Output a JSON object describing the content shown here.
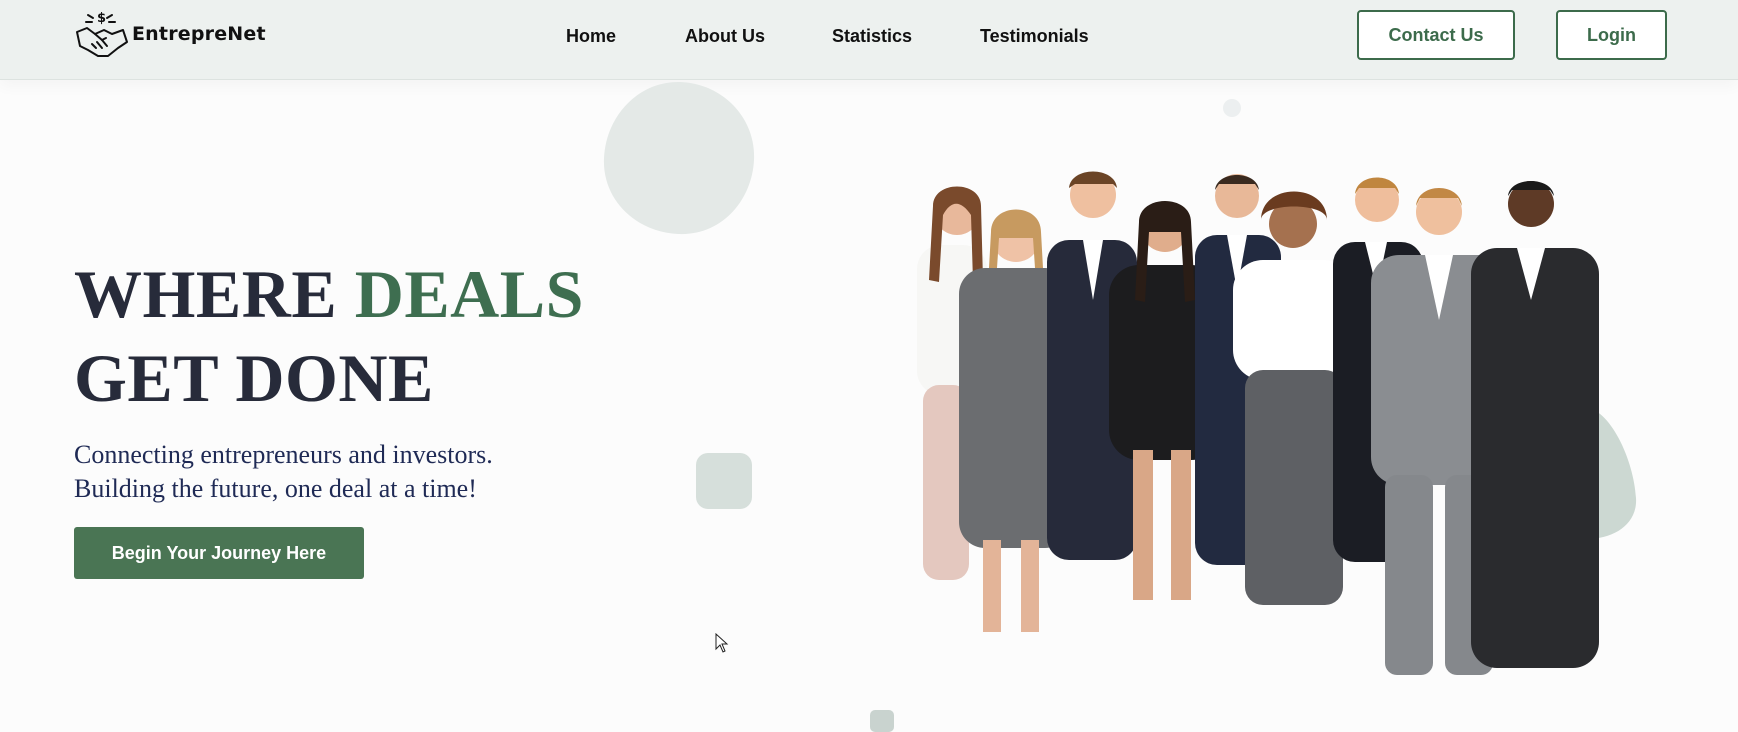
{
  "brand": {
    "name": "EntrepreNet",
    "logo_icon": "handshake-dollar-icon"
  },
  "nav": {
    "links": [
      {
        "label": "Home"
      },
      {
        "label": "About Us"
      },
      {
        "label": "Statistics"
      },
      {
        "label": "Testimonials"
      }
    ],
    "contact_label": "Contact Us",
    "login_label": "Login"
  },
  "hero": {
    "title_part1": "WHERE ",
    "title_accent": "DEALS",
    "title_line2": "GET DONE",
    "subtitle_line1": "Connecting entrepreneurs and investors.",
    "subtitle_line2": "Building the future, one deal at a time!",
    "cta_label": "Begin Your Journey Here",
    "image": "business-team-photo"
  },
  "colors": {
    "accent_green": "#3e6e50",
    "button_green": "#4a7554",
    "heading_dark": "#272b3a",
    "subtitle_navy": "#1f2a55",
    "navbar_bg": "#edf1ef"
  }
}
